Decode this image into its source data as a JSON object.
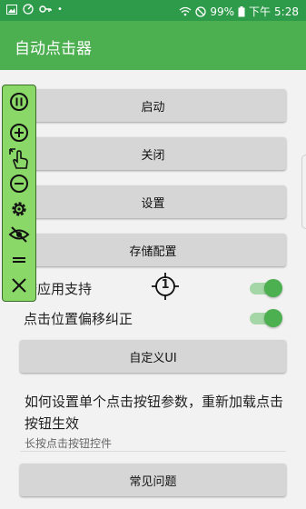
{
  "status": {
    "battery": "99%",
    "ampm": "下午",
    "time": "5:28"
  },
  "app": {
    "title": "自动点击器",
    "bar_color": "#4caf50",
    "status_color": "#2e9b4b"
  },
  "buttons": {
    "start": "启动",
    "close": "关闭",
    "settings": "设置",
    "storage": "存储配置",
    "custom_ui": "自定义UI",
    "faq": "常见问题"
  },
  "switches": {
    "cross_app": {
      "label": "跨应用支持",
      "on": true
    },
    "offset_fix": {
      "label": "点击位置偏移纠正",
      "on": true
    }
  },
  "target": {
    "number": "1"
  },
  "help": {
    "title": "如何设置单个点击按钮参数，重新加载点击按钮生效",
    "subtitle": "长按点击按钮控件"
  },
  "floatbar": {
    "icons": [
      "pause-icon",
      "add-icon",
      "swipe-hand-icon",
      "remove-icon",
      "settings-icon",
      "hide-eye-icon",
      "drag-handle-icon",
      "close-icon"
    ]
  }
}
